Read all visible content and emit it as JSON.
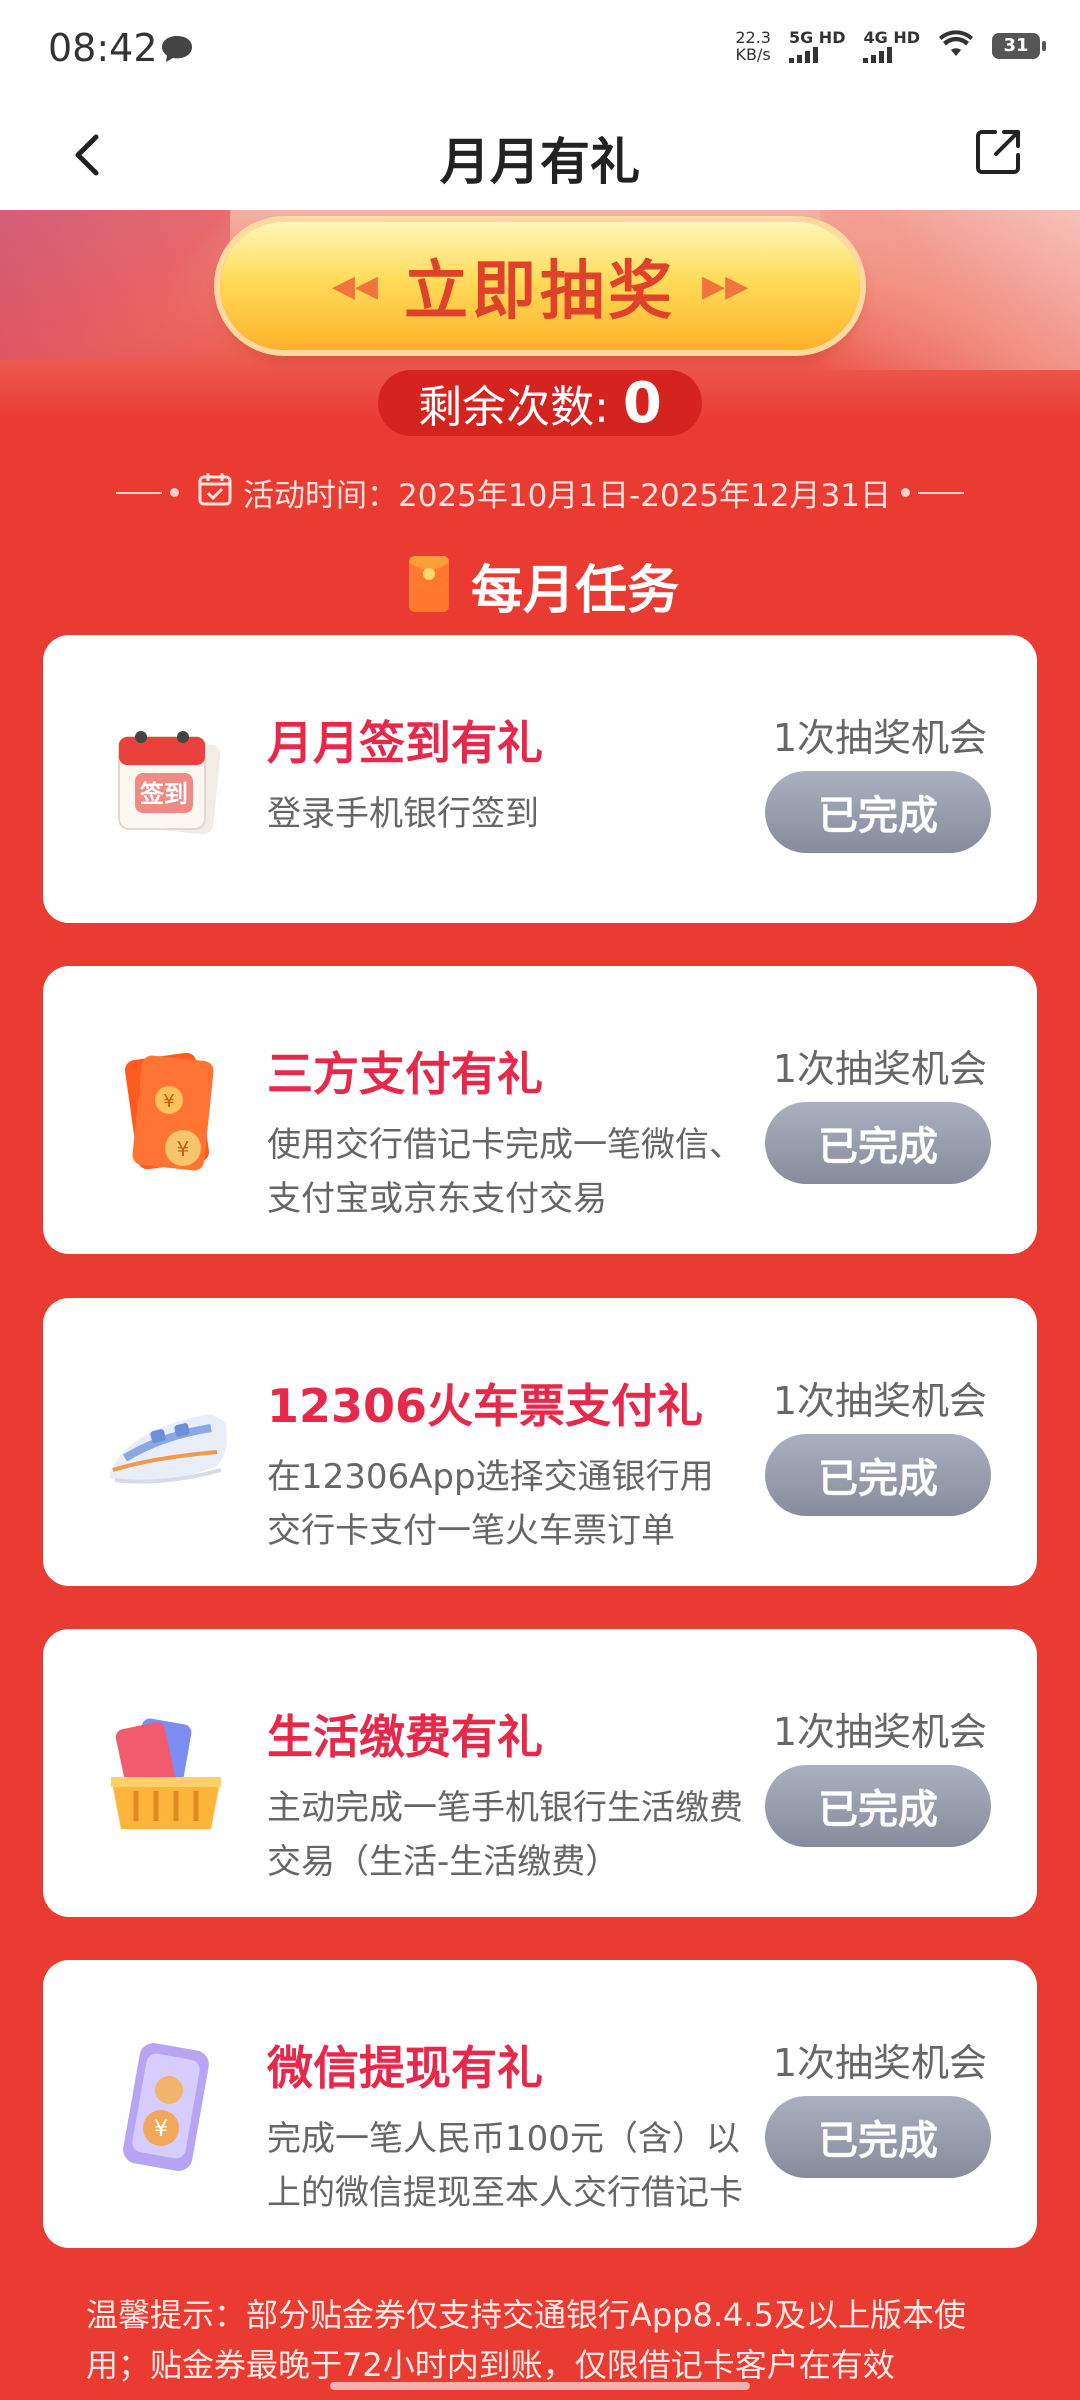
{
  "status_bar": {
    "time": "08:42",
    "net_speed_value": "22.3",
    "net_speed_unit": "KB/s",
    "signal1": "5G HD",
    "signal2": "4G HD",
    "battery": "31",
    "icons": [
      "message-icon",
      "wifi-icon",
      "battery-icon"
    ]
  },
  "nav": {
    "title": "月月有礼",
    "back_icon": "chevron-left-icon",
    "share_icon": "share-icon"
  },
  "banner": {
    "draw_button_label": "立即抽奖",
    "remaining_label": "剩余次数:",
    "remaining_count": "0",
    "activity_period": "活动时间：2025年10月1日-2025年12月31日"
  },
  "section": {
    "title": "每月任务"
  },
  "tasks": [
    {
      "title": "月月签到有礼",
      "desc": "登录手机银行签到",
      "reward": "1次抽奖机会",
      "status": "已完成",
      "icon": "calendar-signin-icon",
      "icon_text": "签到"
    },
    {
      "title": "三方支付有礼",
      "desc": "使用交行借记卡完成一笔微信、支付宝或京东支付交易",
      "reward": "1次抽奖机会",
      "status": "已完成",
      "icon": "red-envelope-icon"
    },
    {
      "title": "12306火车票支付礼",
      "desc": "在12306App选择交通银行用交行卡支付一笔火车票订单",
      "reward": "1次抽奖机会",
      "status": "已完成",
      "icon": "train-icon"
    },
    {
      "title": "生活缴费有礼",
      "desc": "主动完成一笔手机银行生活缴费交易（生活-生活缴费）",
      "reward": "1次抽奖机会",
      "status": "已完成",
      "icon": "cards-basket-icon"
    },
    {
      "title": "微信提现有礼",
      "desc": "完成一笔人民币100元（含）以上的微信提现至本人交行借记卡",
      "reward": "1次抽奖机会",
      "status": "已完成",
      "icon": "phone-coins-icon"
    }
  ],
  "tips": "温馨提示：部分贴金券仅支持交通银行App8.4.5及以上版本使用；贴金券最晚于72小时内到账，仅限借记卡客户在有效",
  "colors": {
    "background": "#ea3b33",
    "task_title": "#e8284a",
    "completed_button": "#8e94a3",
    "draw_button": "#ffd24a"
  }
}
